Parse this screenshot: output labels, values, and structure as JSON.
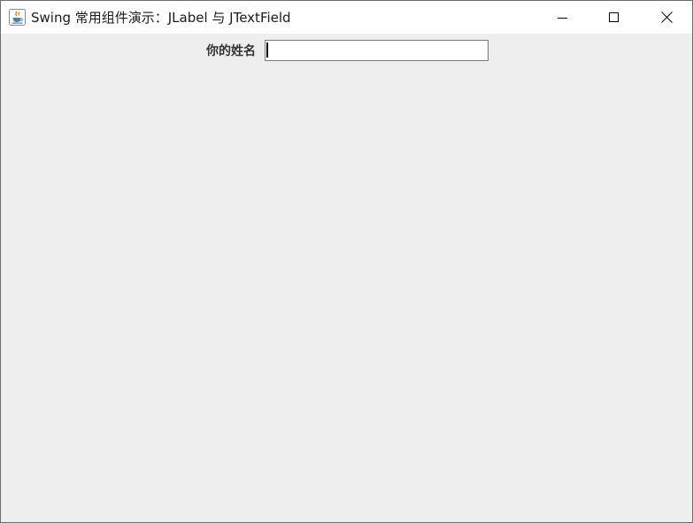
{
  "window": {
    "title": "Swing 常用组件演示：JLabel 与 JTextField",
    "app_icon": "java-coffee-icon",
    "controls": {
      "minimize_icon": "minimize-icon",
      "maximize_icon": "maximize-icon",
      "close_icon": "close-icon"
    }
  },
  "form": {
    "name_label": "你的姓名",
    "name_value": "",
    "name_placeholder": ""
  },
  "colors": {
    "titlebar_bg": "#ffffff",
    "content_bg": "#eeeeee",
    "field_border": "#7a7a7a",
    "java_red": "#e76f00",
    "java_blue": "#5382a1"
  }
}
